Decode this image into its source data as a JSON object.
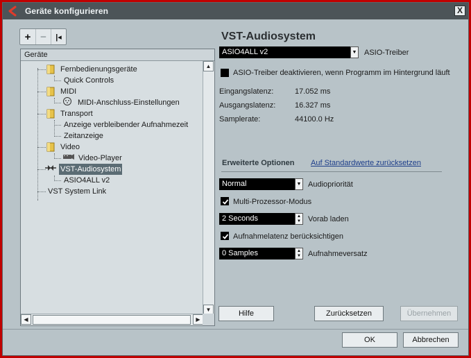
{
  "window": {
    "title": "Geräte konfigurieren",
    "close_label": "X"
  },
  "toolbar": {
    "add_label": "+",
    "remove_label": "−",
    "reset_label": "|◂"
  },
  "tree": {
    "header": "Geräte",
    "items": [
      {
        "label": "Fernbedienungsgeräte"
      },
      {
        "label": "Quick Controls"
      },
      {
        "label": "MIDI"
      },
      {
        "label": "MIDI-Anschluss-Einstellungen"
      },
      {
        "label": "Transport"
      },
      {
        "label": "Anzeige verbleibender Aufnahmezeit"
      },
      {
        "label": "Zeitanzeige"
      },
      {
        "label": "Video"
      },
      {
        "label": "Video-Player"
      },
      {
        "label": "VST-Audiosystem"
      },
      {
        "label": "ASIO4ALL v2"
      },
      {
        "label": "VST System Link"
      }
    ],
    "selected": "VST-Audiosystem"
  },
  "panel": {
    "heading": "VST-Audiosystem",
    "driver_value": "ASIO4ALL v2",
    "driver_label": "ASIO-Treiber",
    "deactivate_label": "ASIO-Treiber deaktivieren, wenn Programm im Hintergrund läuft",
    "deactivate_checked": false,
    "input_latency_label": "Eingangslatenz:",
    "input_latency_value": "17.052 ms",
    "output_latency_label": "Ausgangslatenz:",
    "output_latency_value": "16.327 ms",
    "samplerate_label": "Samplerate:",
    "samplerate_value": "44100.0 Hz",
    "advanced_tab": "Erweiterte Optionen",
    "defaults_link": "Auf Standardwerte zurücksetzen",
    "priority_value": "Normal",
    "priority_label": "Audiopriorität",
    "multiproc_label": "Multi-Prozessor-Modus",
    "multiproc_checked": true,
    "preload_value": "2 Seconds",
    "preload_label": "Vorab laden",
    "reclatency_label": "Aufnahmelatenz berücksichtigen",
    "reclatency_checked": true,
    "offset_value": "0 Samples",
    "offset_label": "Aufnahmeversatz"
  },
  "buttons": {
    "help": "Hilfe",
    "reset": "Zurücksetzen",
    "apply": "Übernehmen",
    "ok": "OK",
    "cancel": "Abbrechen"
  },
  "colors": {
    "background": "#b8c3c8",
    "titlebar": "#4c5458",
    "selection": "#5b6c74",
    "link": "#1c3d8a",
    "frame": "#c00000"
  }
}
